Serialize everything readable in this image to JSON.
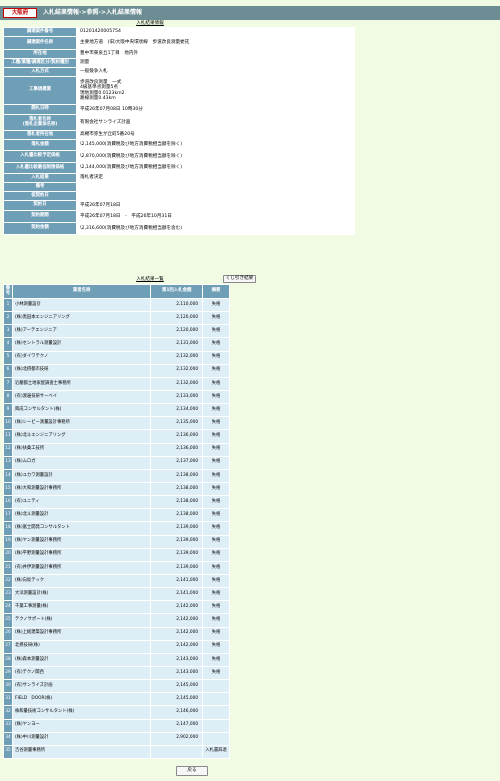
{
  "header": {
    "prefecture": "大阪府",
    "breadcrumb": "入札結果情報->参照->入札結果情報"
  },
  "info_title": "入札結果情報",
  "info": [
    {
      "k": "調達案件番号",
      "v": "01201420005754"
    },
    {
      "k": "調達案件名称",
      "v": "主要地方道　(旧)大阪中央環状線　歩道改良測量委託"
    },
    {
      "k": "所在地",
      "v": "豊中市東泉丘1丁目　地内外"
    },
    {
      "k": "工種/業種/調達区分/契約種別",
      "v": "測量"
    },
    {
      "k": "入札方式",
      "v": "一般競争入札"
    },
    {
      "k": "工事規模業",
      "v": "歩道改良測量　一式\n4級基準点測量5点\n現地測量0.0123km2\n路線測量0.43km"
    },
    {
      "k": "開札日時",
      "v": "平成26年07月08日 10時30分"
    },
    {
      "k": "落札者名称\n(落札企業体名称)",
      "v": "有限会社サンライズ計画"
    },
    {
      "k": "落札者所在地",
      "v": "高槻市弥生が丘町5番20号"
    },
    {
      "k": "落札金額",
      "v": "\\2,145,000(消費税及び地方消費税相当額を除く)"
    },
    {
      "k": "入札書比較予定価格",
      "v": "\\2,870,000(消費税及び地方消費税相当額を除く)"
    },
    {
      "k": "入札書比較最低制限価格",
      "v": "\\2,144,000(消費税及び地方消費税相当額を除く)"
    },
    {
      "k": "入札結果",
      "v": "落札者決定"
    },
    {
      "k": "備考",
      "v": ""
    },
    {
      "k": "仮契約日",
      "v": ""
    },
    {
      "k": "契約日",
      "v": "平成26年07月18日"
    },
    {
      "k": "契約期間",
      "v": "平成26年07月18日　-　平成26年10月31日"
    },
    {
      "k": "契約金額",
      "v": "\\2,316,600(消費税及び地方消費税相当額を含む)"
    }
  ],
  "list_title": "入札結果一覧",
  "lottery_button": "くじ引き結果",
  "columns": [
    "番号",
    "業者名称",
    "第1回入札金額",
    "摘要"
  ],
  "rows": [
    {
      "no": "1",
      "name": "小林測量設計",
      "amount": "2,110,000",
      "remark": "失格"
    },
    {
      "no": "2",
      "name": "(株)黒田本エンジニアリング",
      "amount": "2,120,000",
      "remark": "失格"
    },
    {
      "no": "3",
      "name": "(株)アーテエンジニア",
      "amount": "2,120,000",
      "remark": "失格"
    },
    {
      "no": "4",
      "name": "(株)セントラル測量設計",
      "amount": "2,131,000",
      "remark": "失格"
    },
    {
      "no": "5",
      "name": "(有)ダイワテクノ",
      "amount": "2,132,000",
      "remark": "失格"
    },
    {
      "no": "6",
      "name": "(株)北摂都市技研",
      "amount": "2,132,000",
      "remark": "失格"
    },
    {
      "no": "7",
      "name": "近畿都土地家屋調査士事務所",
      "amount": "2,132,000",
      "remark": "失格"
    },
    {
      "no": "8",
      "name": "(有)渡邊技研サーベイ",
      "amount": "2,133,000",
      "remark": "失格"
    },
    {
      "no": "9",
      "name": "興成コンサルタント(株)",
      "amount": "2,134,000",
      "remark": "失格"
    },
    {
      "no": "10",
      "name": "(株)シービー測量設計事務所",
      "amount": "2,135,000",
      "remark": "失格"
    },
    {
      "no": "11",
      "name": "(株)北斗エンジニアリング",
      "amount": "2,136,000",
      "remark": "失格"
    },
    {
      "no": "12",
      "name": "(株)扶桑工技所",
      "amount": "2,136,000",
      "remark": "失格"
    },
    {
      "no": "13",
      "name": "(株)ムロガ",
      "amount": "2,137,000",
      "remark": "失格"
    },
    {
      "no": "14",
      "name": "(株)ユカワ測量設計",
      "amount": "2,138,000",
      "remark": "失格"
    },
    {
      "no": "15",
      "name": "(株)大和測量設計事務所",
      "amount": "2,138,000",
      "remark": "失格"
    },
    {
      "no": "16",
      "name": "(有)ユニティ",
      "amount": "2,138,000",
      "remark": "失格"
    },
    {
      "no": "17",
      "name": "(株)北斗測量設計",
      "amount": "2,138,000",
      "remark": "失格"
    },
    {
      "no": "18",
      "name": "(株)富士開発コンサルタント",
      "amount": "2,139,000",
      "remark": "失格"
    },
    {
      "no": "19",
      "name": "(株)ヤン測量設計事務所",
      "amount": "2,139,000",
      "remark": "失格"
    },
    {
      "no": "20",
      "name": "(株)平野測量設計事務所",
      "amount": "2,139,000",
      "remark": "失格"
    },
    {
      "no": "21",
      "name": "(有)井伊測量設計事務所",
      "amount": "2,139,000",
      "remark": "失格"
    },
    {
      "no": "22",
      "name": "(株)向坂テック",
      "amount": "2,141,000",
      "remark": "失格"
    },
    {
      "no": "23",
      "name": "大洋測量設計(株)",
      "amount": "2,141,000",
      "remark": "失格"
    },
    {
      "no": "24",
      "name": "千葉工事測量(株)",
      "amount": "2,142,000",
      "remark": "失格"
    },
    {
      "no": "25",
      "name": "テクノサポート(株)",
      "amount": "2,142,000",
      "remark": "失格"
    },
    {
      "no": "26",
      "name": "(株)上総建築設計事務所",
      "amount": "2,142,000",
      "remark": "失格"
    },
    {
      "no": "27",
      "name": "北摂技研(株)",
      "amount": "2,142,000",
      "remark": "失格"
    },
    {
      "no": "28",
      "name": "(株)森本測量設計",
      "amount": "2,143,000",
      "remark": "失格"
    },
    {
      "no": "29",
      "name": "(有)テクノ関西",
      "amount": "2,143,000",
      "remark": "失格"
    },
    {
      "no": "30",
      "name": "(有)サンライズ計画",
      "amount": "2,145,000",
      "remark": ""
    },
    {
      "no": "31",
      "name": "FIELD　DOOR(株)",
      "amount": "2,145,000",
      "remark": ""
    },
    {
      "no": "32",
      "name": "株和量技術コンサルタント(株)",
      "amount": "2,146,000",
      "remark": ""
    },
    {
      "no": "33",
      "name": "(株)ヤンヨー",
      "amount": "2,147,000",
      "remark": ""
    },
    {
      "no": "34",
      "name": "(株)中川測量設計",
      "amount": "2,902,000",
      "remark": ""
    },
    {
      "no": "35",
      "name": "吉谷測量事務所",
      "amount": "",
      "remark": "入札書辞退"
    }
  ],
  "back_button": "戻る"
}
